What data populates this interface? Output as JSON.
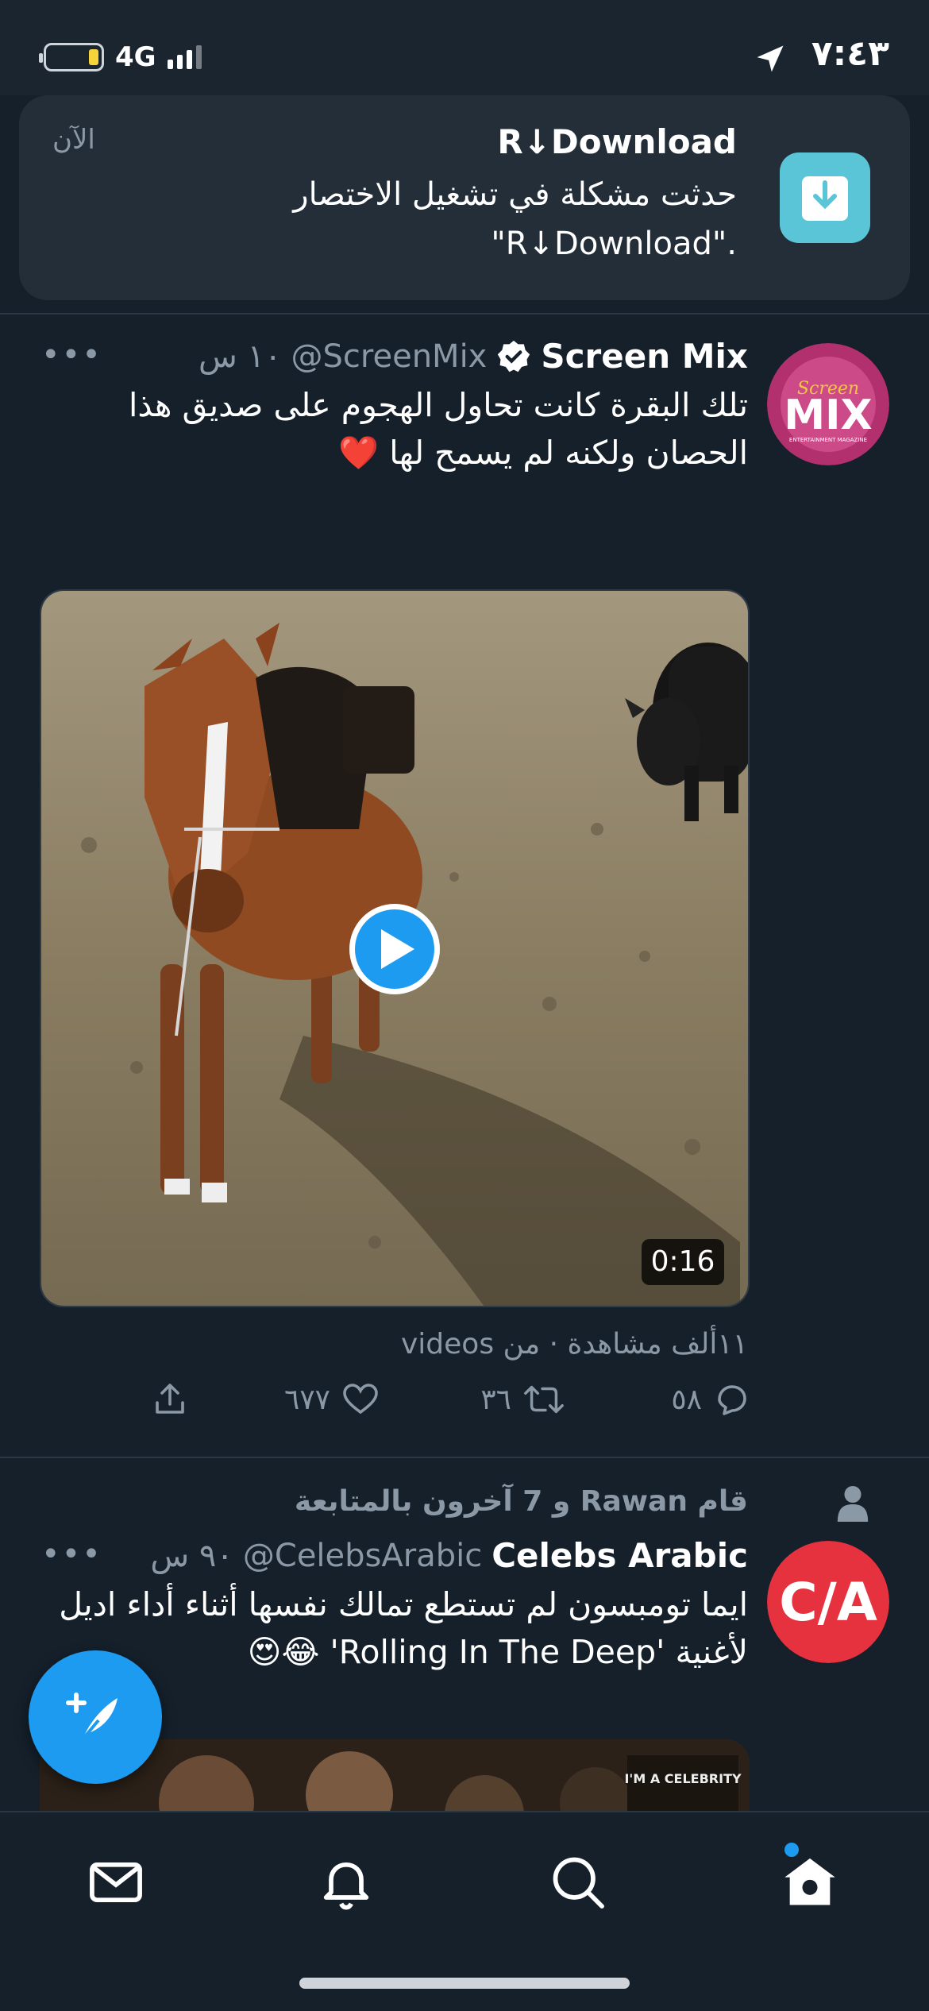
{
  "status_bar": {
    "time": "٧:٤٣",
    "network": "4G",
    "battery_color": "#f5d33a"
  },
  "notification": {
    "app_name": "R↓Download",
    "body_line1": "حدثت مشكلة في تشغيل الاختصار",
    "body_line2": "\"R↓Download\".",
    "time": "الآن"
  },
  "tweet1": {
    "name": "Screen Mix",
    "handle": "@ScreenMix",
    "time": "١٠ س",
    "text_line1": "تلك البقرة كانت تحاول الهجوم على صديق هذا",
    "text_line2": "الحصان ولكنه لم يسمح لها ❤️",
    "video_duration": "0:16",
    "views": "١١ألف مشاهدة · من videos",
    "replies": "٥٨",
    "retweets": "٣٦",
    "likes": "٦٧٧"
  },
  "tweet2": {
    "social_context": "قام Rawan و 7 آخرون بالمتابعة",
    "name": "Celebs Arabic",
    "handle": "@CelebsArabic",
    "time": "٩٠ س",
    "text_line1": "ايما تومبسون لم تستطع تمالك نفسها أثناء أداء اديل",
    "text_line2": "لأغنية 'Rolling In The Deep' 😂😍"
  },
  "colors": {
    "background": "#15202b",
    "accent": "#1d9bf0",
    "secondary_text": "#8b98a5"
  },
  "icons": {
    "tabs": [
      "mail-icon",
      "bell-icon",
      "search-icon",
      "home-icon"
    ]
  }
}
